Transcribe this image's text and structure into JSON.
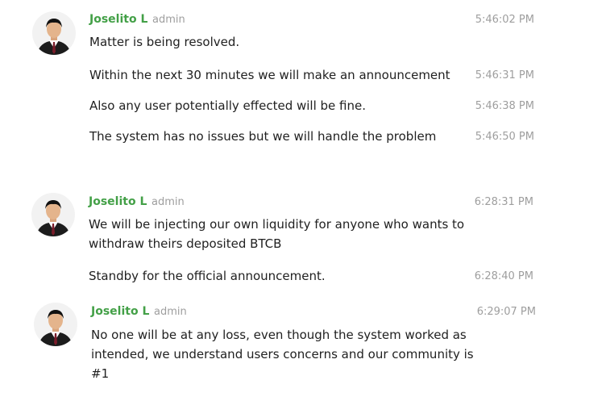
{
  "accent_color": "#43a047",
  "groups": [
    {
      "author": "Joselito L",
      "role": "admin",
      "avatar_icon": "user-avatar-icon",
      "messages": [
        {
          "lines": [
            "Matter is being resolved."
          ],
          "time": "5:46:02 PM"
        },
        {
          "lines": [
            "Within the next 30 minutes we will make an announcement"
          ],
          "time": "5:46:31 PM"
        },
        {
          "lines": [
            "Also any user potentially effected will be fine."
          ],
          "time": "5:46:38 PM"
        },
        {
          "lines": [
            "The system has no issues but we will handle the problem"
          ],
          "time": "5:46:50 PM"
        }
      ]
    },
    {
      "author": "Joselito L",
      "role": "admin",
      "avatar_icon": "user-avatar-icon",
      "messages": [
        {
          "lines": [
            "We will be injecting our own liquidity for anyone who wants to",
            "withdraw theirs deposited BTCB"
          ],
          "time": "6:28:31 PM"
        },
        {
          "lines": [
            "Standby for the official announcement."
          ],
          "time": "6:28:40 PM"
        }
      ]
    },
    {
      "author": "Joselito L",
      "role": "admin",
      "avatar_icon": "user-avatar-icon",
      "messages": [
        {
          "lines": [
            "No one will be at any loss, even though the system worked as",
            "intended, we understand users concerns and our community is",
            "#1"
          ],
          "time": "6:29:07 PM"
        }
      ]
    }
  ]
}
